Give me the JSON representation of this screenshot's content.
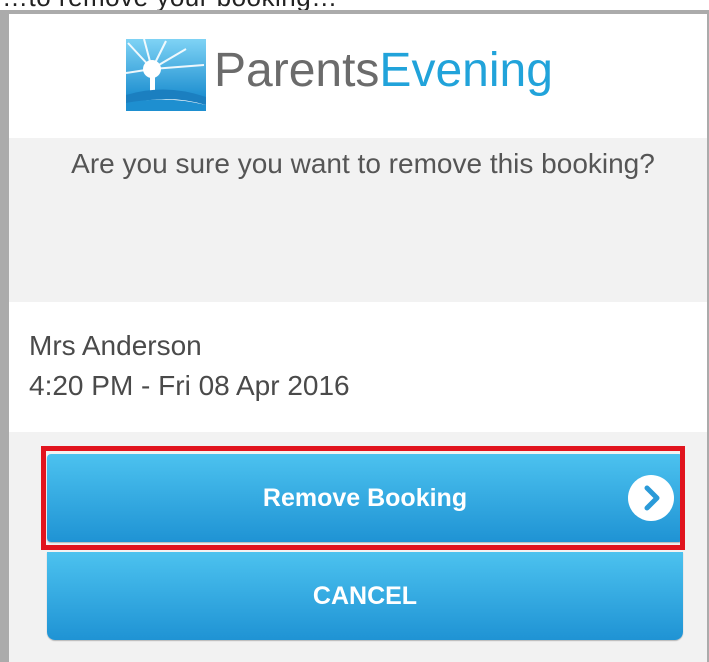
{
  "top_cropped_text": "…to remove your booking…",
  "brand": {
    "part1": "Parents",
    "part2": "Evening",
    "colors": {
      "primary": "#21a3da",
      "grey": "#6b6b6b"
    }
  },
  "dialog": {
    "question": "Are you sure you want to remove this booking?",
    "booking": {
      "teacher": "Mrs Anderson",
      "time": "4:20 PM - Fri 08 Apr 2016"
    }
  },
  "buttons": {
    "remove_label": "Remove Booking",
    "remove_icon": "chevron-right-circle-icon",
    "cancel_label": "CANCEL"
  },
  "colors": {
    "button": "#1f93d4",
    "highlight": "#e1141e"
  }
}
